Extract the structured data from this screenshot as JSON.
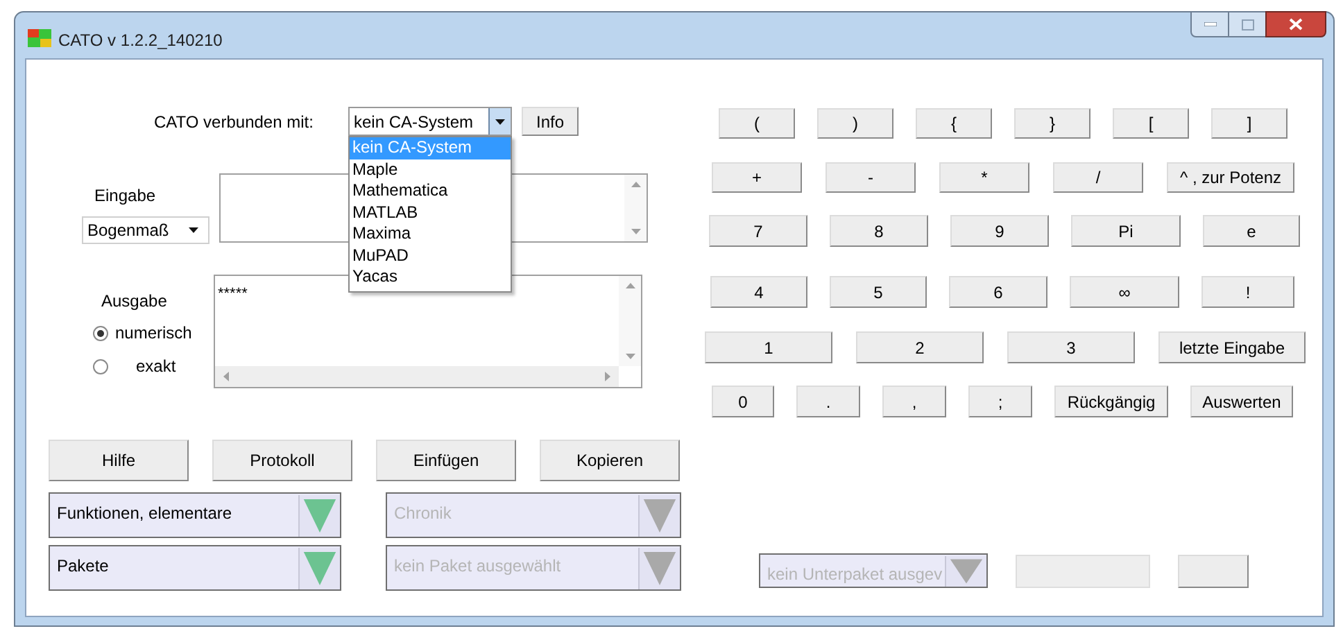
{
  "window": {
    "title": "CATO v 1.2.2_140210"
  },
  "connection": {
    "label": "CATO verbunden mit:",
    "value": "kein CA-System",
    "info_button": "Info",
    "dropdown": {
      "expanded": true,
      "options": [
        {
          "label": "kein CA-System",
          "selected": true
        },
        {
          "label": "Maple",
          "selected": false
        },
        {
          "label": "Mathematica",
          "selected": false
        },
        {
          "label": "MATLAB",
          "selected": false
        },
        {
          "label": "Maxima",
          "selected": false
        },
        {
          "label": "MuPAD",
          "selected": false
        },
        {
          "label": "Yacas",
          "selected": false
        }
      ]
    }
  },
  "input": {
    "label": "Eingabe",
    "angle_mode": "Bogenmaß"
  },
  "output": {
    "label": "Ausgabe",
    "text": "*****",
    "modes": [
      {
        "label": "numerisch",
        "selected": true
      },
      {
        "label": "exakt",
        "selected": false
      }
    ]
  },
  "buttons": [
    "Hilfe",
    "Protokoll",
    "Einfügen",
    "Kopieren"
  ],
  "selectors": [
    {
      "label": "Funktionen, elementare",
      "disabled": false
    },
    {
      "label": "Chronik",
      "disabled": true
    },
    {
      "label": "Pakete",
      "disabled": false
    },
    {
      "label": "kein Paket ausgewählt",
      "disabled": true
    }
  ],
  "keypad": [
    [
      "(",
      ")",
      "{",
      "}",
      "[",
      "]"
    ],
    [
      "+",
      "-",
      "*",
      "/",
      "^ , zur Potenz"
    ],
    [
      "7",
      "8",
      "9",
      "Pi",
      "e"
    ],
    [
      "4",
      "5",
      "6",
      "∞",
      "!"
    ],
    [
      "1",
      "2",
      "3",
      "letzte Eingabe"
    ],
    [
      "0",
      ".",
      ",",
      ";",
      "Rückgängig",
      "Auswerten"
    ]
  ],
  "subpackage": {
    "label": "kein Unterpaket ausgev",
    "disabled": true
  }
}
